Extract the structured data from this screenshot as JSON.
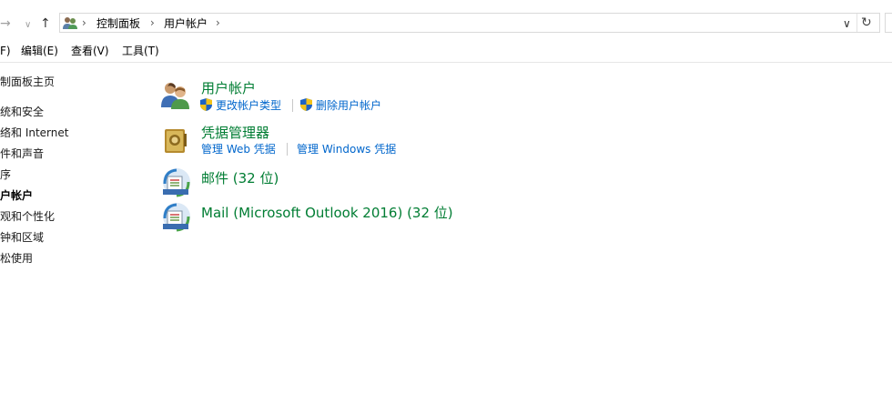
{
  "address": {
    "crumbs": [
      "控制面板",
      "用户帐户"
    ],
    "separator": "›"
  },
  "menu": {
    "items": [
      "F)",
      "编辑(E)",
      "查看(V)",
      "工具(T)"
    ]
  },
  "sidebar": {
    "items": [
      "制面板主页",
      "统和安全",
      "络和 Internet",
      "件和声音",
      "序",
      "户帐户",
      "观和个性化",
      "钟和区域",
      "松使用"
    ],
    "selected_index": 5
  },
  "categories": [
    {
      "title": "用户帐户",
      "tasks": [
        "更改帐户类型",
        "删除用户帐户"
      ]
    },
    {
      "title": "凭据管理器",
      "tasks": [
        "管理 Web 凭据",
        "管理 Windows 凭据"
      ]
    },
    {
      "title": "邮件 (32 位)"
    },
    {
      "title": "Mail (Microsoft Outlook 2016) (32 位)"
    }
  ],
  "colors": {
    "category_title": "#007d33",
    "task_link": "#0066cc"
  }
}
